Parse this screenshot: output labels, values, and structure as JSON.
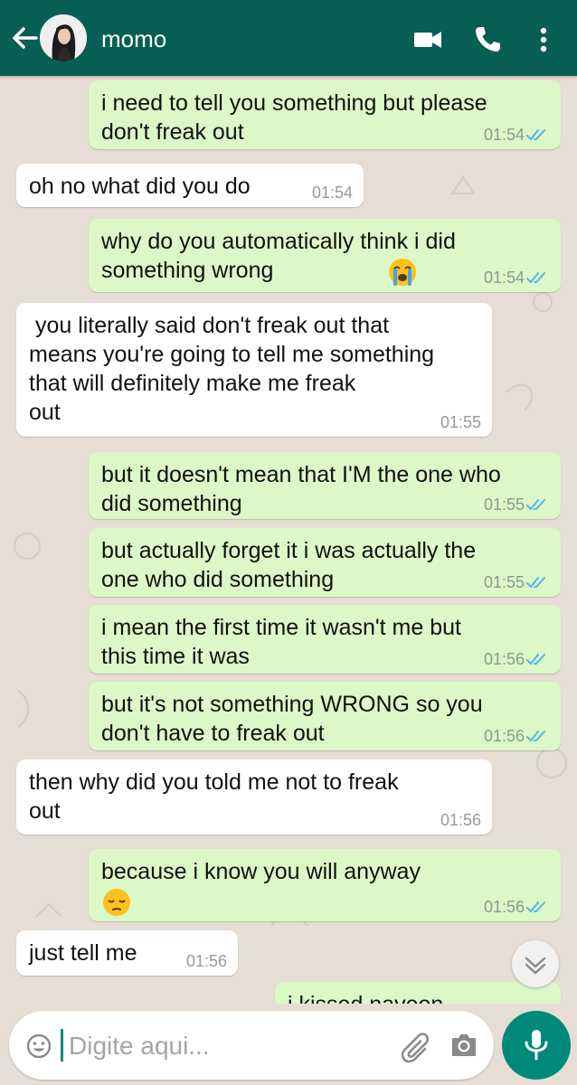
{
  "header": {
    "contact_name": "momo",
    "colors": {
      "bar": "#075e54",
      "accent": "#00897b"
    }
  },
  "messages": [
    {
      "direction": "out",
      "text": "i need to tell you something but please\ndon't freak out",
      "time": "01:54",
      "status": "read"
    },
    {
      "direction": "in",
      "text": "oh no what did you do",
      "time": "01:54"
    },
    {
      "direction": "out",
      "text": "why do you automatically think i did\nsomething wrong",
      "emoji": "loudly-crying-face",
      "time": "01:54",
      "status": "read"
    },
    {
      "direction": "in",
      "text": " you literally said don't freak out that\nmeans you're going to tell me something\nthat will definitely make me freak\nout",
      "time": "01:55"
    },
    {
      "direction": "out",
      "text": "but it doesn't mean that I'M the one who\ndid something",
      "time": "01:55",
      "status": "read"
    },
    {
      "direction": "out",
      "text": "but actually forget it i was actually the\none who did something",
      "time": "01:55",
      "status": "read"
    },
    {
      "direction": "out",
      "text": "i mean the first time it wasn't me but\nthis time it was",
      "time": "01:56",
      "status": "read"
    },
    {
      "direction": "out",
      "text": "but it's not something WRONG so you\ndon't have to freak out",
      "time": "01:56",
      "status": "read"
    },
    {
      "direction": "in",
      "text": "then why did you told me not to freak\nout",
      "time": "01:56"
    },
    {
      "direction": "out",
      "text": "because i know you will anyway",
      "emoji": "pensive-face",
      "time": "01:56",
      "status": "read"
    },
    {
      "direction": "in",
      "text": "just tell me",
      "time": "01:56"
    },
    {
      "direction": "out",
      "text": "i kissed nayeon",
      "partially_visible": true
    }
  ],
  "composer": {
    "placeholder": "Digite aqui..."
  },
  "icons": {
    "back": "arrow-left-icon",
    "video": "video-call-icon",
    "call": "phone-icon",
    "menu": "more-vert-icon",
    "emoji": "emoji-icon",
    "attach": "paperclip-icon",
    "camera": "camera-icon",
    "mic": "microphone-icon",
    "scroll": "chevron-double-down-icon"
  }
}
